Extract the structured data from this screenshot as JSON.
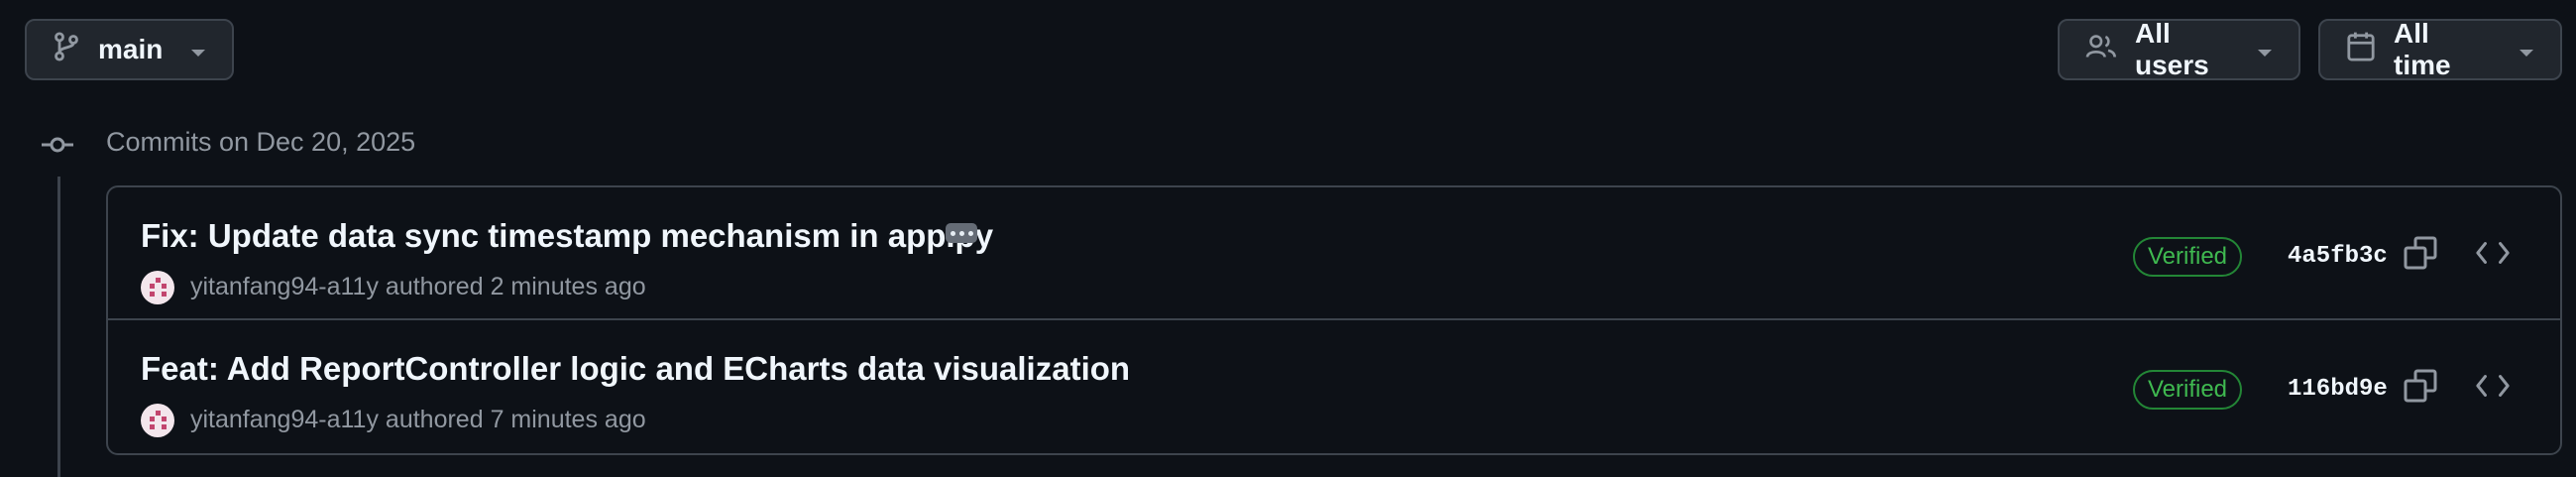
{
  "toolbar": {
    "branch": {
      "label": "main",
      "icon": "git-branch-icon"
    },
    "users_filter": {
      "label": "All users",
      "icon": "people-icon"
    },
    "time_filter": {
      "label": "All time",
      "icon": "calendar-icon"
    }
  },
  "commit_group": {
    "heading": "Commits on Dec 20, 2025",
    "commits": [
      {
        "title": "Fix: Update data sync timestamp mechanism in app.py",
        "has_more_message": true,
        "author": "yitanfang94-a11y",
        "action": "authored",
        "time": "2 minutes ago",
        "badge": "Verified",
        "sha": "4a5fb3c"
      },
      {
        "title": "Feat: Add ReportController logic and ECharts data visualization",
        "has_more_message": false,
        "author": "yitanfang94-a11y",
        "action": "authored",
        "time": "7 minutes ago",
        "badge": "Verified",
        "sha": "116bd9e"
      }
    ]
  },
  "colors": {
    "background": "#0d1117",
    "border": "#3d444d",
    "button_bg": "#21262d",
    "verified_green": "#3fb950",
    "muted_text": "#9198a1"
  }
}
